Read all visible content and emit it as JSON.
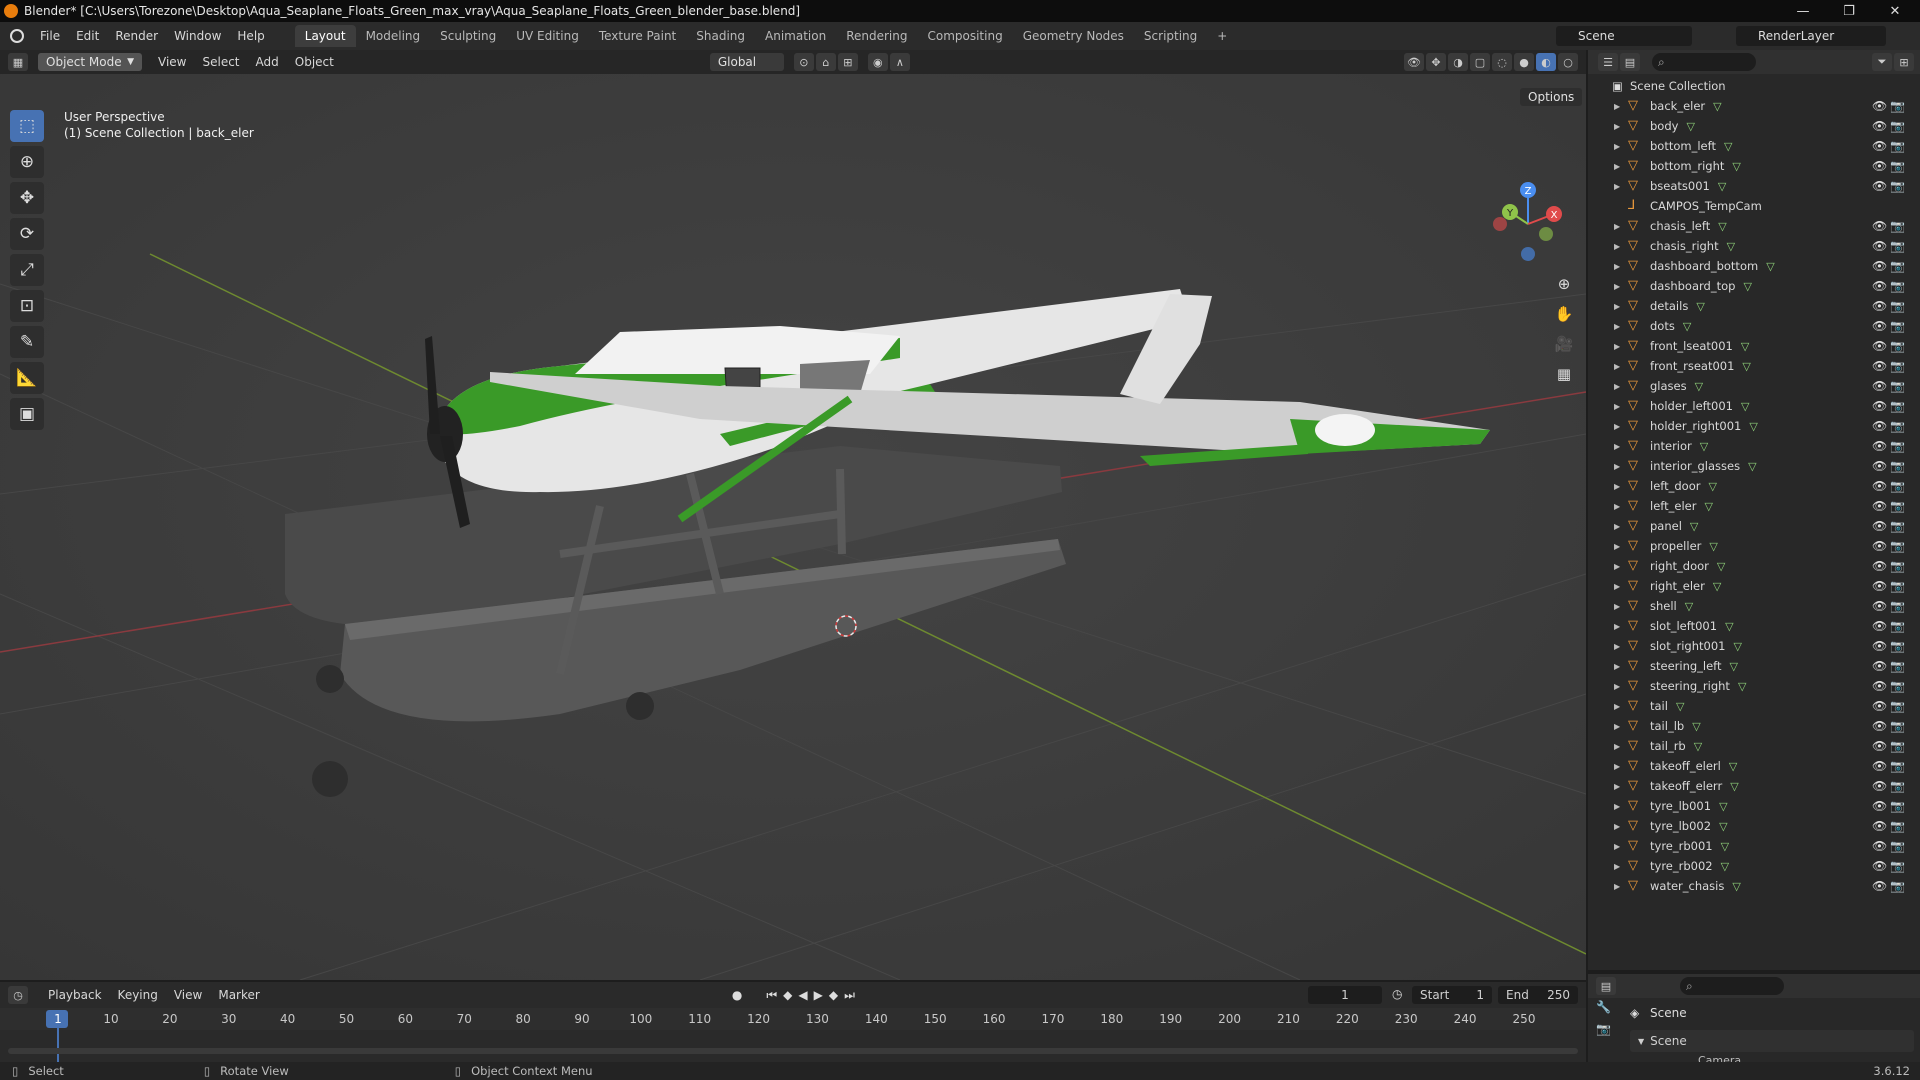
{
  "window": {
    "title": "Blender* [C:\\Users\\Torezone\\Desktop\\Aqua_Seaplane_Floats_Green_max_vray\\Aqua_Seaplane_Floats_Green_blender_base.blend]",
    "minimize": "—",
    "restore": "❐",
    "close": "✕"
  },
  "menus": [
    "File",
    "Edit",
    "Render",
    "Window",
    "Help"
  ],
  "workspaces": [
    "Layout",
    "Modeling",
    "Sculpting",
    "UV Editing",
    "Texture Paint",
    "Shading",
    "Animation",
    "Rendering",
    "Compositing",
    "Geometry Nodes",
    "Scripting",
    "+"
  ],
  "active_workspace": "Layout",
  "scene_name": "Scene",
  "view_layer": "RenderLayer",
  "viewport_header": {
    "mode": "Object Mode",
    "menus": [
      "View",
      "Select",
      "Add",
      "Object"
    ],
    "orientation": "Global",
    "options": "Options"
  },
  "viewport": {
    "perspective": "User Perspective",
    "context": "(1) Scene Collection | back_eler",
    "gizmo_axes": [
      "Z",
      "Y",
      "X"
    ]
  },
  "tools": [
    "select-box",
    "cursor",
    "move",
    "rotate",
    "scale",
    "transform",
    "annotate",
    "measure",
    "add-cube"
  ],
  "outliner": {
    "root": "Scene Collection",
    "items": [
      {
        "name": "back_eler",
        "type": "mesh"
      },
      {
        "name": "body",
        "type": "mesh"
      },
      {
        "name": "bottom_left",
        "type": "mesh"
      },
      {
        "name": "bottom_right",
        "type": "mesh"
      },
      {
        "name": "bseats001",
        "type": "mesh"
      },
      {
        "name": "CAMPOS_TempCam",
        "type": "empty"
      },
      {
        "name": "chasis_left",
        "type": "mesh"
      },
      {
        "name": "chasis_right",
        "type": "mesh"
      },
      {
        "name": "dashboard_bottom",
        "type": "mesh"
      },
      {
        "name": "dashboard_top",
        "type": "mesh"
      },
      {
        "name": "details",
        "type": "mesh"
      },
      {
        "name": "dots",
        "type": "mesh"
      },
      {
        "name": "front_lseat001",
        "type": "mesh"
      },
      {
        "name": "front_rseat001",
        "type": "mesh"
      },
      {
        "name": "glases",
        "type": "mesh"
      },
      {
        "name": "holder_left001",
        "type": "mesh"
      },
      {
        "name": "holder_right001",
        "type": "mesh"
      },
      {
        "name": "interior",
        "type": "mesh"
      },
      {
        "name": "interior_glasses",
        "type": "mesh"
      },
      {
        "name": "left_door",
        "type": "mesh"
      },
      {
        "name": "left_eler",
        "type": "mesh"
      },
      {
        "name": "panel",
        "type": "mesh"
      },
      {
        "name": "propeller",
        "type": "mesh"
      },
      {
        "name": "right_door",
        "type": "mesh"
      },
      {
        "name": "right_eler",
        "type": "mesh"
      },
      {
        "name": "shell",
        "type": "mesh"
      },
      {
        "name": "slot_left001",
        "type": "mesh"
      },
      {
        "name": "slot_right001",
        "type": "mesh"
      },
      {
        "name": "steering_left",
        "type": "mesh"
      },
      {
        "name": "steering_right",
        "type": "mesh"
      },
      {
        "name": "tail",
        "type": "mesh"
      },
      {
        "name": "tail_lb",
        "type": "mesh"
      },
      {
        "name": "tail_rb",
        "type": "mesh"
      },
      {
        "name": "takeoff_elerl",
        "type": "mesh"
      },
      {
        "name": "takeoff_elerr",
        "type": "mesh"
      },
      {
        "name": "tyre_lb001",
        "type": "mesh"
      },
      {
        "name": "tyre_lb002",
        "type": "mesh"
      },
      {
        "name": "tyre_rb001",
        "type": "mesh"
      },
      {
        "name": "tyre_rb002",
        "type": "mesh"
      },
      {
        "name": "water_chasis",
        "type": "mesh"
      }
    ]
  },
  "properties": {
    "context": "Scene",
    "panel": "Scene",
    "field": "Camera"
  },
  "timeline": {
    "menus": [
      "Playback",
      "Keying",
      "View",
      "Marker"
    ],
    "current_frame": "1",
    "start_label": "Start",
    "start": "1",
    "end_label": "End",
    "end": "250",
    "ticks": [
      "1",
      "10",
      "20",
      "30",
      "40",
      "50",
      "60",
      "70",
      "80",
      "90",
      "100",
      "110",
      "120",
      "130",
      "140",
      "150",
      "160",
      "170",
      "180",
      "190",
      "200",
      "210",
      "220",
      "230",
      "240",
      "250"
    ]
  },
  "statusbar": {
    "select": "Select",
    "rotate": "Rotate View",
    "context_menu": "Object Context Menu",
    "version": "3.6.12"
  },
  "colors": {
    "plane_green": "#3a9a28",
    "plane_white": "#e6e6e6",
    "float_gray": "#555555",
    "accent_blue": "#4772b3",
    "object_orange": "#e8983c"
  }
}
